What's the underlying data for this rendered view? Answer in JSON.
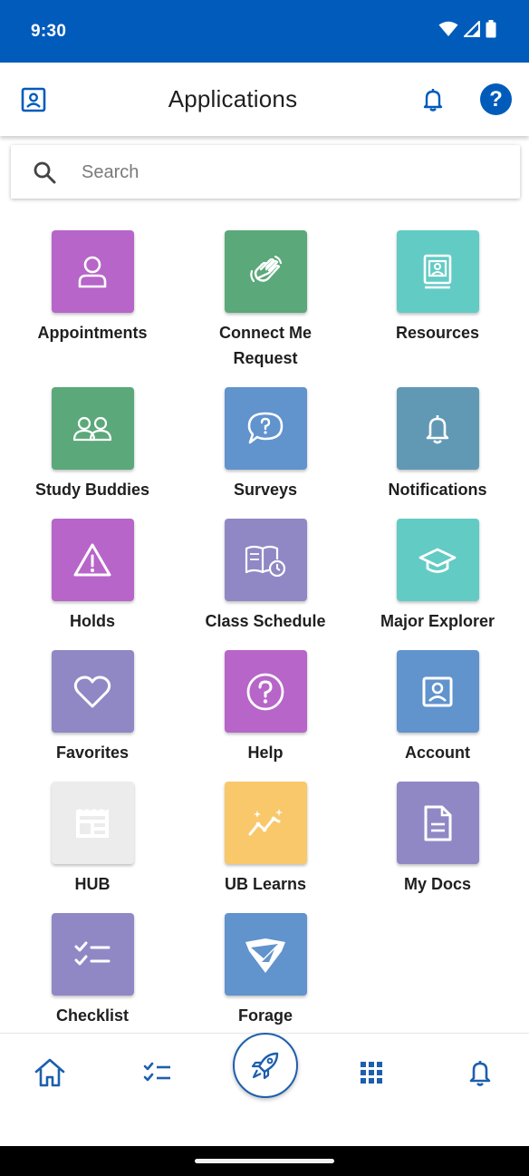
{
  "status_bar": {
    "time": "9:30"
  },
  "header": {
    "title": "Applications"
  },
  "search": {
    "placeholder": "Search"
  },
  "colors": {
    "brand_blue": "#005bbb",
    "purple": "#b765c9",
    "green": "#5ba87a",
    "teal": "#62cbc4",
    "blue": "#6193cd",
    "steel": "#6199b5",
    "lavender": "#8f88c5",
    "yellow": "#f9c86a",
    "light_gray": "#ececec"
  },
  "apps": [
    {
      "label": "Appointments",
      "icon": "person-icon",
      "color": "purple"
    },
    {
      "label": "Connect Me\nRequest",
      "icon": "wave-hand-icon",
      "color": "green"
    },
    {
      "label": "Resources",
      "icon": "id-card-icon",
      "color": "teal"
    },
    {
      "label": "Study Buddies",
      "icon": "people-icon",
      "color": "green"
    },
    {
      "label": "Surveys",
      "icon": "question-bubble-icon",
      "color": "blue"
    },
    {
      "label": "Notifications",
      "icon": "bell-icon",
      "color": "steel"
    },
    {
      "label": "Holds",
      "icon": "warning-icon",
      "color": "purple"
    },
    {
      "label": "Class Schedule",
      "icon": "book-clock-icon",
      "color": "lavender"
    },
    {
      "label": "Major Explorer",
      "icon": "graduation-cap-icon",
      "color": "teal"
    },
    {
      "label": "Favorites",
      "icon": "heart-icon",
      "color": "lavender"
    },
    {
      "label": "Help",
      "icon": "help-circle-icon",
      "color": "purple"
    },
    {
      "label": "Account",
      "icon": "account-card-icon",
      "color": "blue"
    },
    {
      "label": "HUB",
      "icon": "newspaper-icon",
      "color": "light_gray"
    },
    {
      "label": "UB Learns",
      "icon": "sparkle-chart-icon",
      "color": "yellow"
    },
    {
      "label": "My Docs",
      "icon": "document-icon",
      "color": "lavender"
    },
    {
      "label": "Checklist",
      "icon": "checklist-icon",
      "color": "lavender"
    },
    {
      "label": "Forage",
      "icon": "forage-logo-icon",
      "color": "blue"
    }
  ],
  "bottom_nav": {
    "items": [
      {
        "icon": "home-icon"
      },
      {
        "icon": "checklist-nav-icon"
      },
      {
        "icon": "rocket-icon"
      },
      {
        "icon": "apps-grid-icon"
      },
      {
        "icon": "bell-nav-icon"
      }
    ]
  }
}
